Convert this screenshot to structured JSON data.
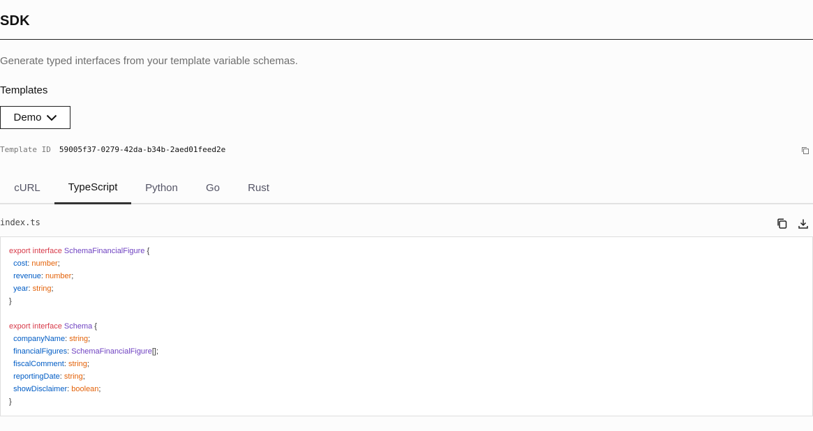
{
  "page": {
    "title": "SDK",
    "subtitle": "Generate typed interfaces from your template variable schemas."
  },
  "templates": {
    "label": "Templates",
    "selected": "Demo",
    "id_label": "Template ID",
    "id_value": "59005f37-0279-42da-b34b-2aed01feed2e"
  },
  "tabs": [
    {
      "label": "cURL",
      "active": false
    },
    {
      "label": "TypeScript",
      "active": true
    },
    {
      "label": "Python",
      "active": false
    },
    {
      "label": "Go",
      "active": false
    },
    {
      "label": "Rust",
      "active": false
    }
  ],
  "file": {
    "name": "index.ts",
    "copy_icon": "copy-icon",
    "download_icon": "download-icon"
  },
  "code": {
    "lines": [
      [
        {
          "t": "export interface ",
          "c": "kw"
        },
        {
          "t": "SchemaFinancialFigure",
          "c": "ty"
        },
        {
          "t": " {",
          "c": "pn"
        }
      ],
      [
        {
          "t": "  cost",
          "c": "pr"
        },
        {
          "t": ": ",
          "c": "pn"
        },
        {
          "t": "number",
          "c": "pt"
        },
        {
          "t": ";",
          "c": "pn"
        }
      ],
      [
        {
          "t": "  revenue",
          "c": "pr"
        },
        {
          "t": ": ",
          "c": "pn"
        },
        {
          "t": "number",
          "c": "pt"
        },
        {
          "t": ";",
          "c": "pn"
        }
      ],
      [
        {
          "t": "  year",
          "c": "pr"
        },
        {
          "t": ": ",
          "c": "pn"
        },
        {
          "t": "string",
          "c": "pt"
        },
        {
          "t": ";",
          "c": "pn"
        }
      ],
      [
        {
          "t": "}",
          "c": "pn"
        }
      ],
      [],
      [
        {
          "t": "export interface ",
          "c": "kw"
        },
        {
          "t": "Schema",
          "c": "ty"
        },
        {
          "t": " {",
          "c": "pn"
        }
      ],
      [
        {
          "t": "  companyName",
          "c": "pr"
        },
        {
          "t": ": ",
          "c": "pn"
        },
        {
          "t": "string",
          "c": "pt"
        },
        {
          "t": ";",
          "c": "pn"
        }
      ],
      [
        {
          "t": "  financialFigures",
          "c": "pr"
        },
        {
          "t": ": ",
          "c": "pn"
        },
        {
          "t": "SchemaFinancialFigure",
          "c": "ty"
        },
        {
          "t": "[];",
          "c": "pn"
        }
      ],
      [
        {
          "t": "  fiscalComment",
          "c": "pr"
        },
        {
          "t": ": ",
          "c": "pn"
        },
        {
          "t": "string",
          "c": "pt"
        },
        {
          "t": ";",
          "c": "pn"
        }
      ],
      [
        {
          "t": "  reportingDate",
          "c": "pr"
        },
        {
          "t": ": ",
          "c": "pn"
        },
        {
          "t": "string",
          "c": "pt"
        },
        {
          "t": ";",
          "c": "pn"
        }
      ],
      [
        {
          "t": "  showDisclaimer",
          "c": "pr"
        },
        {
          "t": ": ",
          "c": "pn"
        },
        {
          "t": "boolean",
          "c": "pt"
        },
        {
          "t": ";",
          "c": "pn"
        }
      ],
      [
        {
          "t": "}",
          "c": "pn"
        }
      ]
    ]
  },
  "colors": {
    "keyword": "#d73a49",
    "type": "#6f42c1",
    "property": "#005cc5",
    "primitive": "#e36209"
  }
}
